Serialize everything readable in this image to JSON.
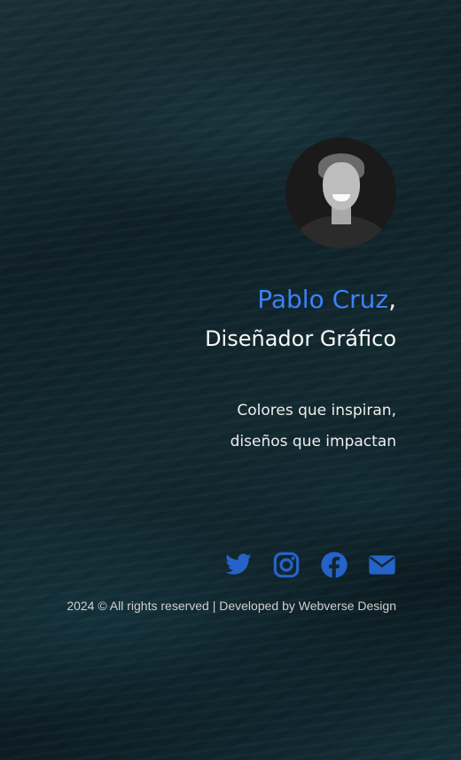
{
  "profile": {
    "name": "Pablo Cruz",
    "name_suffix": ",",
    "role": "Diseñador Gráfico",
    "tagline_line1": "Colores que inspiran,",
    "tagline_line2": "diseños que impactan"
  },
  "social": [
    {
      "icon": "twitter-icon"
    },
    {
      "icon": "instagram-icon"
    },
    {
      "icon": "facebook-icon"
    },
    {
      "icon": "email-icon"
    }
  ],
  "footer": {
    "text": "2024 © All rights reserved | Developed by Webverse Design"
  },
  "colors": {
    "accent": "#3b82f6",
    "icon": "#2563c9",
    "background": "#12262d"
  }
}
